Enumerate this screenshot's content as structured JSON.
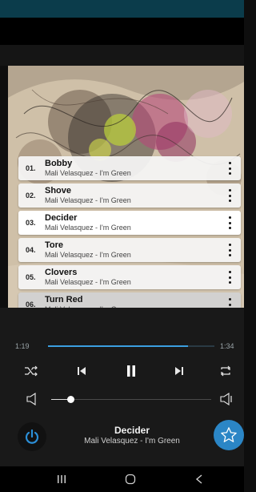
{
  "colors": {
    "accent": "#3b9fe0",
    "favorite": "#2b86c6",
    "status_bar": "#0b3c4b",
    "power_icon": "#2b8fd8"
  },
  "playlist": [
    {
      "number": "01.",
      "title": "Bobby",
      "subtitle": "Mali Velasquez - I'm Green"
    },
    {
      "number": "02.",
      "title": "Shove",
      "subtitle": "Mali Velasquez - I'm Green"
    },
    {
      "number": "03.",
      "title": "Decider",
      "subtitle": "Mali Velasquez - I'm Green"
    },
    {
      "number": "04.",
      "title": "Tore",
      "subtitle": "Mali Velasquez - I'm Green"
    },
    {
      "number": "05.",
      "title": "Clovers",
      "subtitle": "Mali Velasquez - I'm Green"
    },
    {
      "number": "06.",
      "title": "Turn Red",
      "subtitle": "Mali Velasquez - I'm Green"
    }
  ],
  "player": {
    "elapsed": "1:19",
    "duration": "1:34",
    "progress_fraction": 0.84,
    "volume_fraction": 0.12,
    "icons": {
      "shuffle": "shuffle-icon",
      "previous": "skip-previous-icon",
      "play_pause": "pause-icon",
      "next": "skip-next-icon",
      "repeat": "repeat-icon",
      "volume_down": "volume-low-icon",
      "volume_up": "volume-high-icon"
    }
  },
  "now_playing": {
    "title": "Decider",
    "subtitle": "Mali Velasquez - I'm Green",
    "left_icon": "power-icon",
    "right_icon": "favorite-star-icon"
  },
  "nav_bar": {
    "recents_icon": "recents-icon",
    "home_icon": "home-icon",
    "back_icon": "back-icon"
  }
}
